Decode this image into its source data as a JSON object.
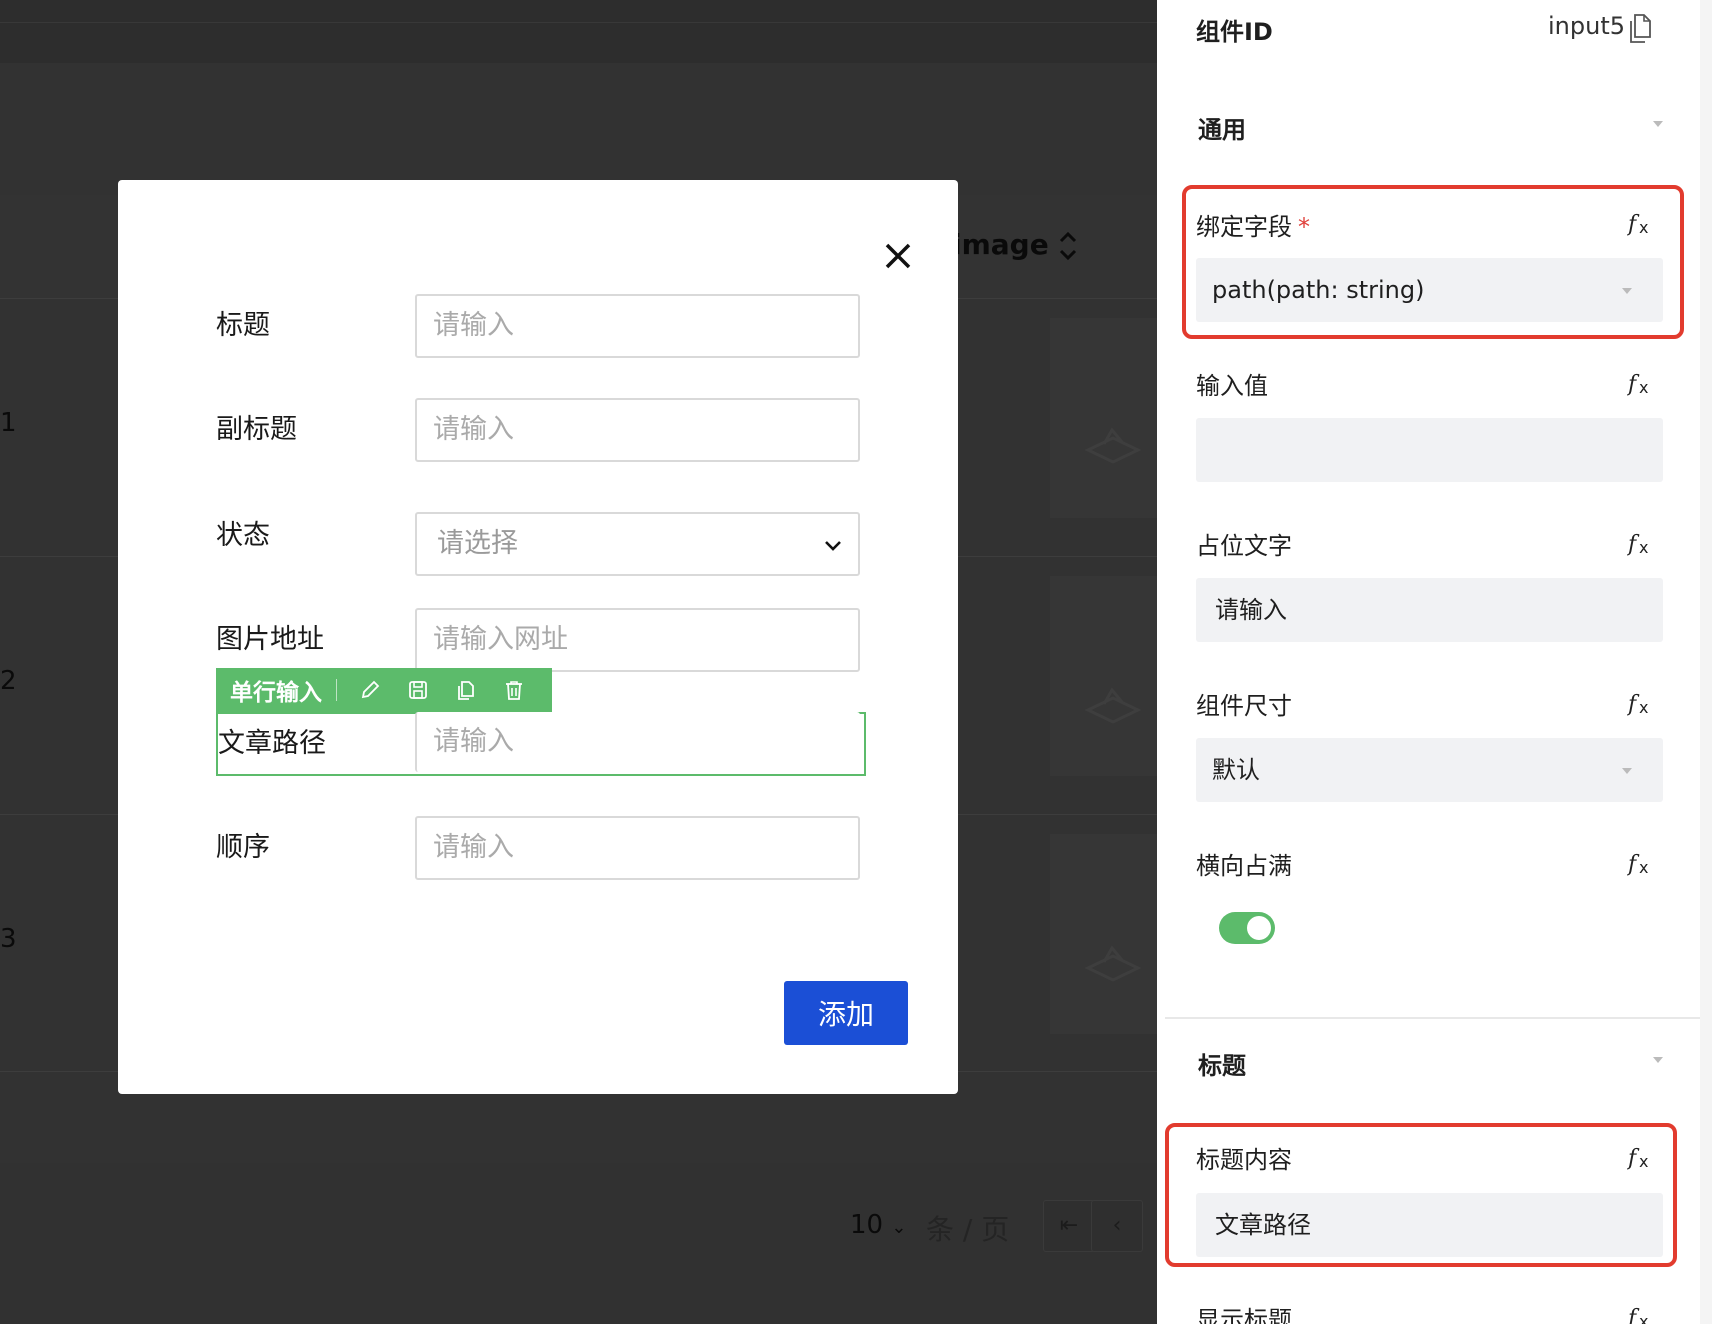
{
  "background": {
    "column_header": "image",
    "row_numbers": [
      "1",
      "2",
      "3"
    ],
    "pagination": {
      "page_size": "10",
      "page_unit": "条 / 页"
    }
  },
  "modal": {
    "fields": [
      {
        "label": "标题",
        "placeholder": "请输入"
      },
      {
        "label": "副标题",
        "placeholder": "请输入"
      },
      {
        "label": "状态",
        "placeholder": "请选择"
      },
      {
        "label": "图片地址",
        "placeholder": "请输入网址"
      },
      {
        "label": "文章路径",
        "placeholder": "请输入"
      },
      {
        "label": "顺序",
        "placeholder": "请输入"
      }
    ],
    "component_toolbar": {
      "name": "单行输入"
    },
    "submit_label": "添加"
  },
  "panel": {
    "component_id_label": "组件ID",
    "component_id_value": "input5",
    "sections": {
      "general": "通用",
      "title": "标题"
    },
    "bind_field": {
      "label": "绑定字段",
      "required_mark": "*",
      "value": "path(path: string)"
    },
    "input_value": {
      "label": "输入值",
      "value": ""
    },
    "placeholder_text": {
      "label": "占位文字",
      "value": "请输入"
    },
    "component_size": {
      "label": "组件尺寸",
      "value": "默认"
    },
    "fill_horizontal": {
      "label": "横向占满",
      "enabled": true
    },
    "title_content": {
      "label": "标题内容",
      "value": "文章路径"
    },
    "show_title": {
      "label": "显示标题"
    }
  },
  "colors": {
    "accent_green": "#5cbb6b",
    "primary_blue": "#1b4fd6",
    "highlight_red": "#e23b2e"
  },
  "icons": [
    "close-icon",
    "chevron-down-icon",
    "edit-icon",
    "save-icon",
    "copy-icon",
    "delete-icon",
    "fx-icon",
    "caret-down-icon",
    "sort-icon",
    "first-page-icon",
    "prev-page-icon"
  ]
}
